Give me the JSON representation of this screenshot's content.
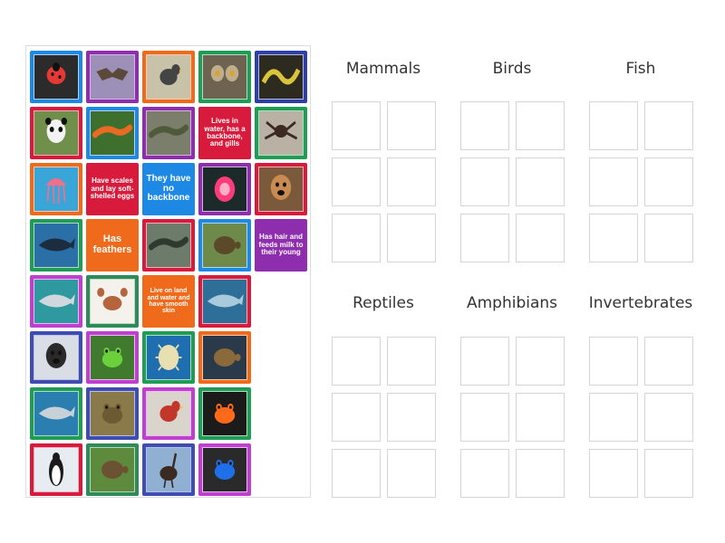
{
  "palette": {
    "blue": "#1e88e5",
    "indigo": "#3f4db3",
    "purple": "#8e2dad",
    "orange": "#f06a1b",
    "green": "#1f9d55",
    "red": "#d81b3c",
    "magenta": "#c03fd0",
    "darkgreen": "#2e8b57",
    "deepblue": "#2f3fa8"
  },
  "cards": [
    {
      "kind": "image",
      "icon": "ladybug-icon",
      "frame": "blue",
      "bg": "#2b2b2b",
      "fg": "#e53935"
    },
    {
      "kind": "image",
      "icon": "bat-icon",
      "frame": "purple",
      "bg": "#9c8fb8",
      "fg": "#5b4a3a"
    },
    {
      "kind": "image",
      "icon": "chickadee-icon",
      "frame": "orange",
      "bg": "#c8c2a8",
      "fg": "#444444"
    },
    {
      "kind": "image",
      "icon": "owl-icon",
      "frame": "green",
      "bg": "#6d6350",
      "fg": "#bfae8a"
    },
    {
      "kind": "image",
      "icon": "snake-icon",
      "frame": "deepblue",
      "bg": "#2d2a1f",
      "fg": "#d9c43c"
    },
    {
      "kind": "image",
      "icon": "panda-icon",
      "frame": "red",
      "bg": "#6f8f4a",
      "fg": "#f2f2f2"
    },
    {
      "kind": "image",
      "icon": "newt-icon",
      "frame": "blue",
      "bg": "#3f6f2f",
      "fg": "#e96a22"
    },
    {
      "kind": "image",
      "icon": "lizard-icon",
      "frame": "purple",
      "bg": "#7a7e6a",
      "fg": "#4e5a3a"
    },
    {
      "kind": "text",
      "text": "Lives in water, has a backbone, and gills",
      "frame": "red",
      "size": 8
    },
    {
      "kind": "image",
      "icon": "tarantula-icon",
      "frame": "green",
      "bg": "#b9b2a4",
      "fg": "#3a2a22"
    },
    {
      "kind": "image",
      "icon": "jellyfish-icon",
      "frame": "orange",
      "bg": "#3aa6d8",
      "fg": "#f0708c"
    },
    {
      "kind": "text",
      "text": "Have scales and lay soft-shelled eggs",
      "frame": "red",
      "size": 8
    },
    {
      "kind": "text",
      "text": "They have no backbone",
      "frame": "blue",
      "size": 10
    },
    {
      "kind": "image",
      "icon": "sea-anemone-icon",
      "frame": "purple",
      "bg": "#1d2a2a",
      "fg": "#ff3c7a"
    },
    {
      "kind": "image",
      "icon": "dog-icon",
      "frame": "red",
      "bg": "#7a5a3a",
      "fg": "#c98b52"
    },
    {
      "kind": "image",
      "icon": "whale-icon",
      "frame": "green",
      "bg": "#2a6fa6",
      "fg": "#1c2d40"
    },
    {
      "kind": "text",
      "text": "Has feathers",
      "frame": "orange",
      "size": 11
    },
    {
      "kind": "image",
      "icon": "iguana-icon",
      "frame": "red",
      "bg": "#6c7b6a",
      "fg": "#2d3a2d"
    },
    {
      "kind": "image",
      "icon": "turtle-icon",
      "frame": "blue",
      "bg": "#6e8a4a",
      "fg": "#5a4a2a"
    },
    {
      "kind": "text",
      "text": "Has hair and feeds milk to their young",
      "frame": "purple",
      "size": 8
    },
    {
      "kind": "image",
      "icon": "shark-icon",
      "frame": "magenta",
      "bg": "#2e9aa0",
      "fg": "#cfd8dc"
    },
    {
      "kind": "image",
      "icon": "crab-icon",
      "frame": "darkgreen",
      "bg": "#f5f1ec",
      "fg": "#b5643c"
    },
    {
      "kind": "text",
      "text": "Live on land and water and have smooth skin",
      "frame": "orange",
      "size": 7
    },
    {
      "kind": "image",
      "icon": "stingray-icon",
      "frame": "red",
      "bg": "#2e6f9a",
      "fg": "#a9c9dc"
    },
    {
      "kind": "image",
      "icon": "tiger-icon",
      "frame": "indigo",
      "bg": "#d9dde6",
      "fg": "#2a2a2a"
    },
    {
      "kind": "image",
      "icon": "tree-frog-icon",
      "frame": "magenta",
      "bg": "#3f7a2f",
      "fg": "#6ad13a"
    },
    {
      "kind": "image",
      "icon": "pufferfish-icon",
      "frame": "green",
      "bg": "#1f6fb0",
      "fg": "#e8e0b0"
    },
    {
      "kind": "image",
      "icon": "sea-turtle-icon",
      "frame": "orange",
      "bg": "#2b3a4a",
      "fg": "#8a6a3a"
    },
    {
      "kind": "image",
      "icon": "great-white-shark-icon",
      "frame": "green",
      "bg": "#2a7fb0",
      "fg": "#c7d1d8"
    },
    {
      "kind": "image",
      "icon": "toad-icon",
      "frame": "indigo",
      "bg": "#8a7a4a",
      "fg": "#6b5a32"
    },
    {
      "kind": "image",
      "icon": "rooster-icon",
      "frame": "magenta",
      "bg": "#d9d4cc",
      "fg": "#c2372a"
    },
    {
      "kind": "image",
      "icon": "poison-frog-icon",
      "frame": "green",
      "bg": "#1b1b1b",
      "fg": "#ff6a1a"
    },
    {
      "kind": "image",
      "icon": "penguin-icon",
      "frame": "red",
      "bg": "#e6ecf2",
      "fg": "#1b1b1b"
    },
    {
      "kind": "image",
      "icon": "tortoise-icon",
      "frame": "darkgreen",
      "bg": "#5e8a3e",
      "fg": "#6a5232"
    },
    {
      "kind": "image",
      "icon": "ostrich-icon",
      "frame": "indigo",
      "bg": "#8fb0d0",
      "fg": "#3a2a22"
    },
    {
      "kind": "image",
      "icon": "blue-poison-frog-icon",
      "frame": "magenta",
      "bg": "#2a2a2a",
      "fg": "#1f6fe8"
    }
  ],
  "groups": [
    {
      "title": "Mammals"
    },
    {
      "title": "Birds"
    },
    {
      "title": "Fish"
    },
    {
      "title": "Reptiles"
    },
    {
      "title": "Amphibians"
    },
    {
      "title": "Invertebrates"
    }
  ]
}
